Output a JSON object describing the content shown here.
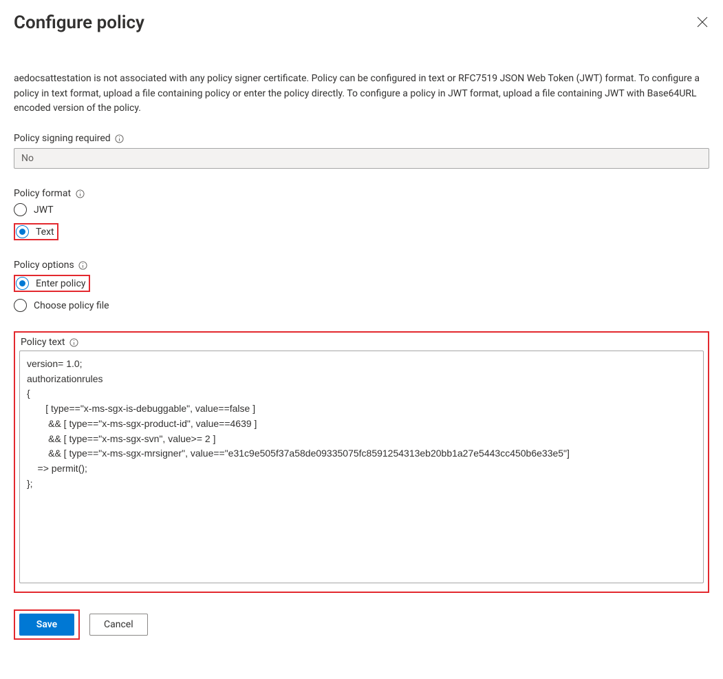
{
  "header": {
    "title": "Configure policy"
  },
  "description": "aedocsattestation is not associated with any policy signer certificate. Policy can be configured in text or RFC7519 JSON Web Token (JWT) format. To configure a policy in text format, upload a file containing policy or enter the policy directly. To configure a policy in JWT format, upload a file containing JWT with Base64URL encoded version of the policy.",
  "signing": {
    "label": "Policy signing required",
    "value": "No"
  },
  "format": {
    "label": "Policy format",
    "options": {
      "jwt": "JWT",
      "text": "Text"
    },
    "selected": "text"
  },
  "options": {
    "label": "Policy options",
    "items": {
      "enter": "Enter policy",
      "choose": "Choose policy file"
    },
    "selected": "enter"
  },
  "policy_text": {
    "label": "Policy text",
    "value": "version= 1.0;\nauthorizationrules\n{\n       [ type==\"x-ms-sgx-is-debuggable\", value==false ]\n        && [ type==\"x-ms-sgx-product-id\", value==4639 ]\n        && [ type==\"x-ms-sgx-svn\", value>= 2 ]\n        && [ type==\"x-ms-sgx-mrsigner\", value==\"e31c9e505f37a58de09335075fc8591254313eb20bb1a27e5443cc450b6e33e5\"]\n    => permit();\n};"
  },
  "buttons": {
    "save": "Save",
    "cancel": "Cancel"
  }
}
